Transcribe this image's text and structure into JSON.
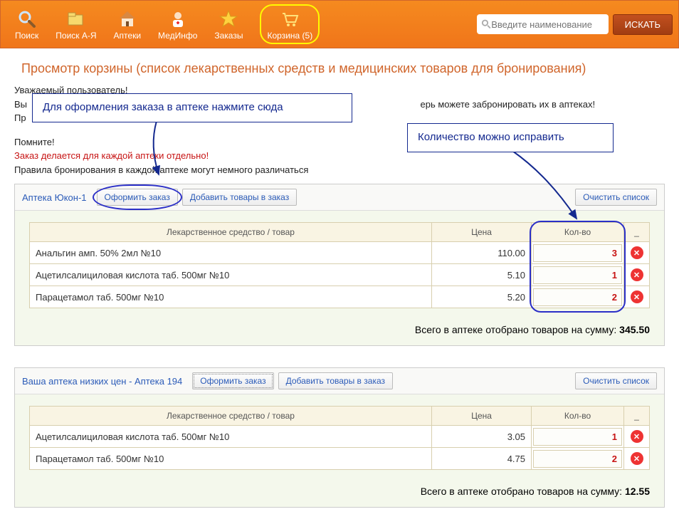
{
  "topbar": {
    "items": [
      {
        "label": "Поиск",
        "icon": "magnifier"
      },
      {
        "label": "Поиск А-Я",
        "icon": "folder"
      },
      {
        "label": "Аптеки",
        "icon": "house"
      },
      {
        "label": "МедИнфо",
        "icon": "doctor"
      },
      {
        "label": "Заказы",
        "icon": "star"
      },
      {
        "label": "Корзина (5)",
        "icon": "cart"
      }
    ],
    "search_placeholder": "Введите наименование",
    "search_button": "ИСКАТЬ"
  },
  "page_title": "Просмотр корзины (список лекарственных средств и медицинских товаров для бронирования)",
  "info": {
    "line1": "Уважаемый пользователь!",
    "line2_prefix": "Вы",
    "line2_suffix": "ерь можете забронировать их в аптеках!",
    "line3": "Пр",
    "line4": "Помните!",
    "line5": "Заказ делается для каждой аптеки отдельно!",
    "line6": "Правила бронирования в каждой аптеке могут немного различаться"
  },
  "callouts": {
    "order": "Для оформления заказа в аптеке нажмите сюда",
    "qty": "Количество можно исправить"
  },
  "table_headers": {
    "product": "Лекарственное средство / товар",
    "price": "Цена",
    "qty": "Кол-во",
    "del": "_"
  },
  "buttons": {
    "order": "Оформить заказ",
    "add": "Добавить товары в заказ",
    "clear": "Очистить список"
  },
  "total_label": "Всего в аптеке отобрано товаров на сумму:",
  "pharmacies": [
    {
      "name": "Аптека Юкон-1",
      "items": [
        {
          "product": "Анальгин амп. 50% 2мл №10",
          "price": "110.00",
          "qty": "3"
        },
        {
          "product": "Ацетилсалициловая кислота таб. 500мг №10",
          "price": "5.10",
          "qty": "1"
        },
        {
          "product": "Парацетамол таб. 500мг №10",
          "price": "5.20",
          "qty": "2"
        }
      ],
      "total": "345.50"
    },
    {
      "name": "Ваша аптека низких цен - Аптека 194",
      "items": [
        {
          "product": "Ацетилсалициловая кислота таб. 500мг №10",
          "price": "3.05",
          "qty": "1"
        },
        {
          "product": "Парацетамол таб. 500мг №10",
          "price": "4.75",
          "qty": "2"
        }
      ],
      "total": "12.55"
    }
  ]
}
